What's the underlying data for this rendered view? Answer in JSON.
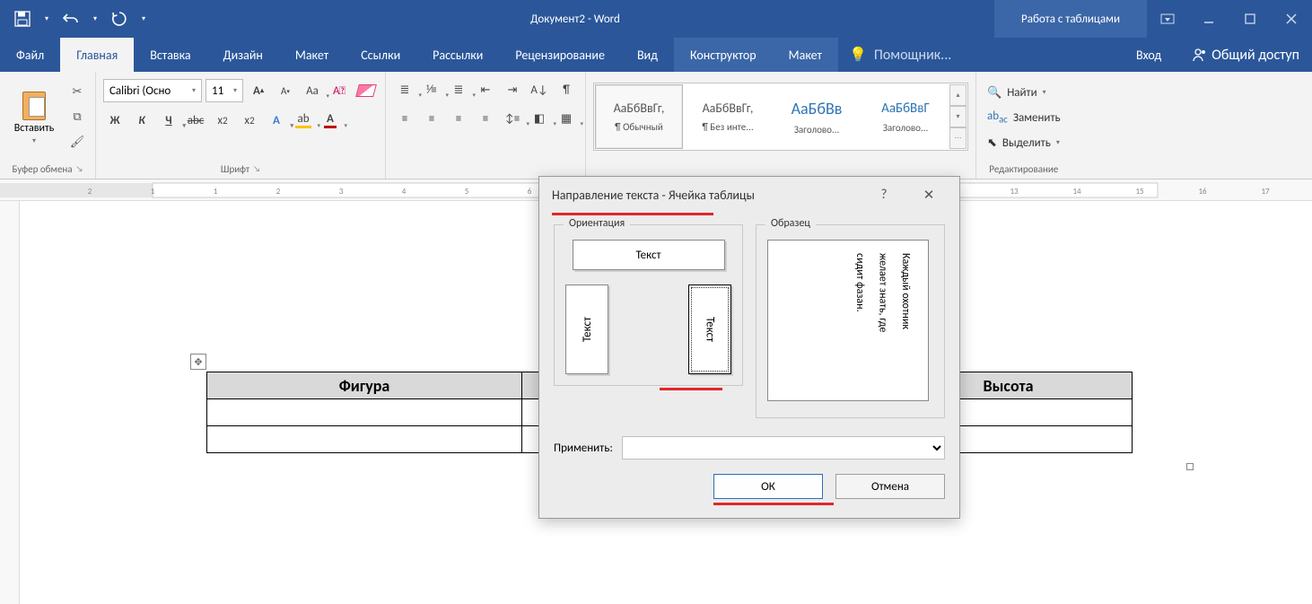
{
  "titlebar": {
    "doc_title": "Документ2 - Word",
    "tooltabs_title": "Работа с таблицами"
  },
  "tabs": {
    "file": "Файл",
    "home": "Главная",
    "insert": "Вставка",
    "design": "Дизайн",
    "layout": "Макет",
    "references": "Ссылки",
    "mailings": "Рассылки",
    "review": "Рецензирование",
    "view": "Вид",
    "design_tool": "Конструктор",
    "layout_tool": "Макет",
    "tellme": "Помощник...",
    "signin": "Вход",
    "share": "Общий доступ"
  },
  "ribbon": {
    "clipboard_label": "Буфер обмена",
    "paste": "Вставить",
    "font_label": "Шрифт",
    "font_name": "Calibri (Осно",
    "font_size": "11",
    "styles": {
      "s1_preview": "АаБбВвГг,",
      "s1_name": "¶ Обычный",
      "s2_preview": "АаБбВвГг,",
      "s2_name": "¶ Без инте...",
      "s3_preview": "АаБбВв",
      "s3_name": "Заголово...",
      "s4_preview": "АаБбВвГ",
      "s4_name": "Заголово..."
    },
    "editing_label": "Редактирование",
    "find": "Найти",
    "replace": "Заменить",
    "select": "Выделить"
  },
  "doc": {
    "col_figure": "Фигура",
    "col_height": "Высота"
  },
  "dialog": {
    "title": "Направление текста - Ячейка таблицы",
    "orientation": "Ориентация",
    "sample": "Образец",
    "text": "Текст",
    "sample_line1": "Каждый охотник",
    "sample_line2": "желает знать, где",
    "sample_line3": "сидит фазан.",
    "apply": "Применить:",
    "ok": "ОК",
    "cancel": "Отмена"
  }
}
